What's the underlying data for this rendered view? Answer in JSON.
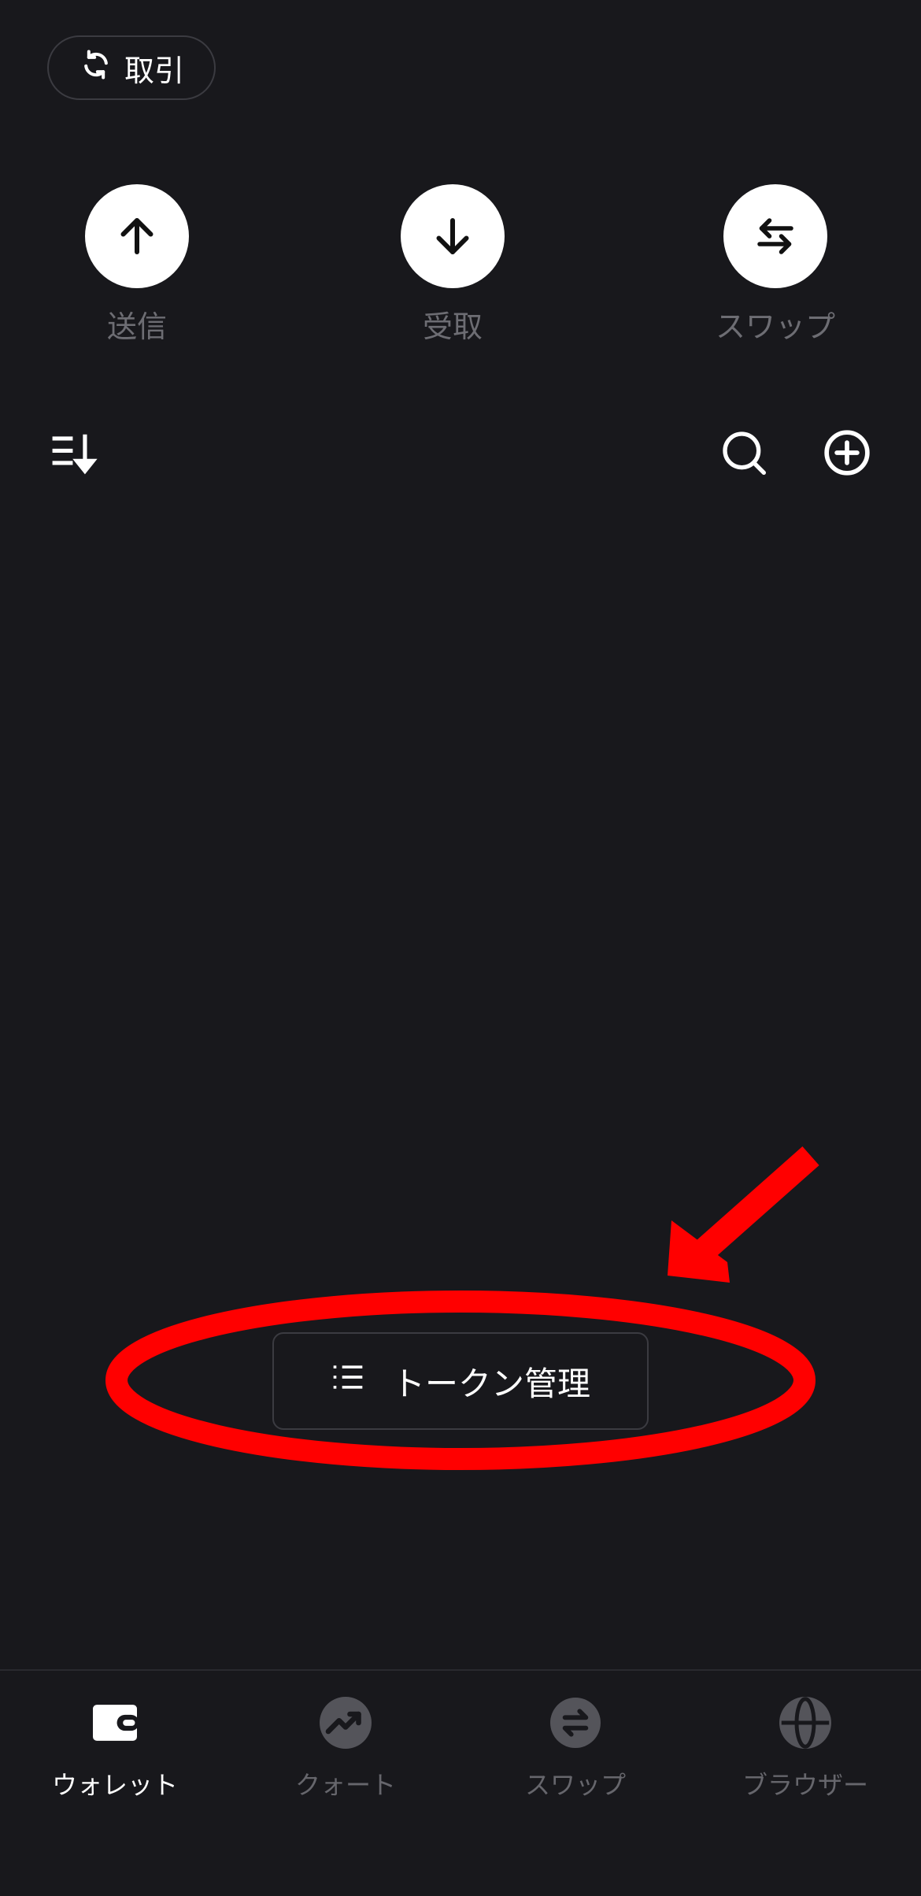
{
  "header": {
    "trade_label": "取引"
  },
  "actions": [
    {
      "label": "送信",
      "icon": "arrow-up-icon"
    },
    {
      "label": "受取",
      "icon": "arrow-down-icon"
    },
    {
      "label": "スワップ",
      "icon": "swap-arrows-icon"
    }
  ],
  "toolbar": {
    "sort_icon": "sort-icon",
    "search_icon": "search-icon",
    "add_icon": "add-circle-icon"
  },
  "token_manage": {
    "label": "トークン管理",
    "icon": "list-icon"
  },
  "annotation": {
    "color": "#ff0000"
  },
  "tabbar": {
    "tabs": [
      {
        "label": "ウォレット",
        "icon": "wallet-icon",
        "active": true
      },
      {
        "label": "クォート",
        "icon": "chart-icon",
        "active": false
      },
      {
        "label": "スワップ",
        "icon": "swap-icon",
        "active": false
      },
      {
        "label": "ブラウザー",
        "icon": "globe-icon",
        "active": false
      }
    ]
  }
}
